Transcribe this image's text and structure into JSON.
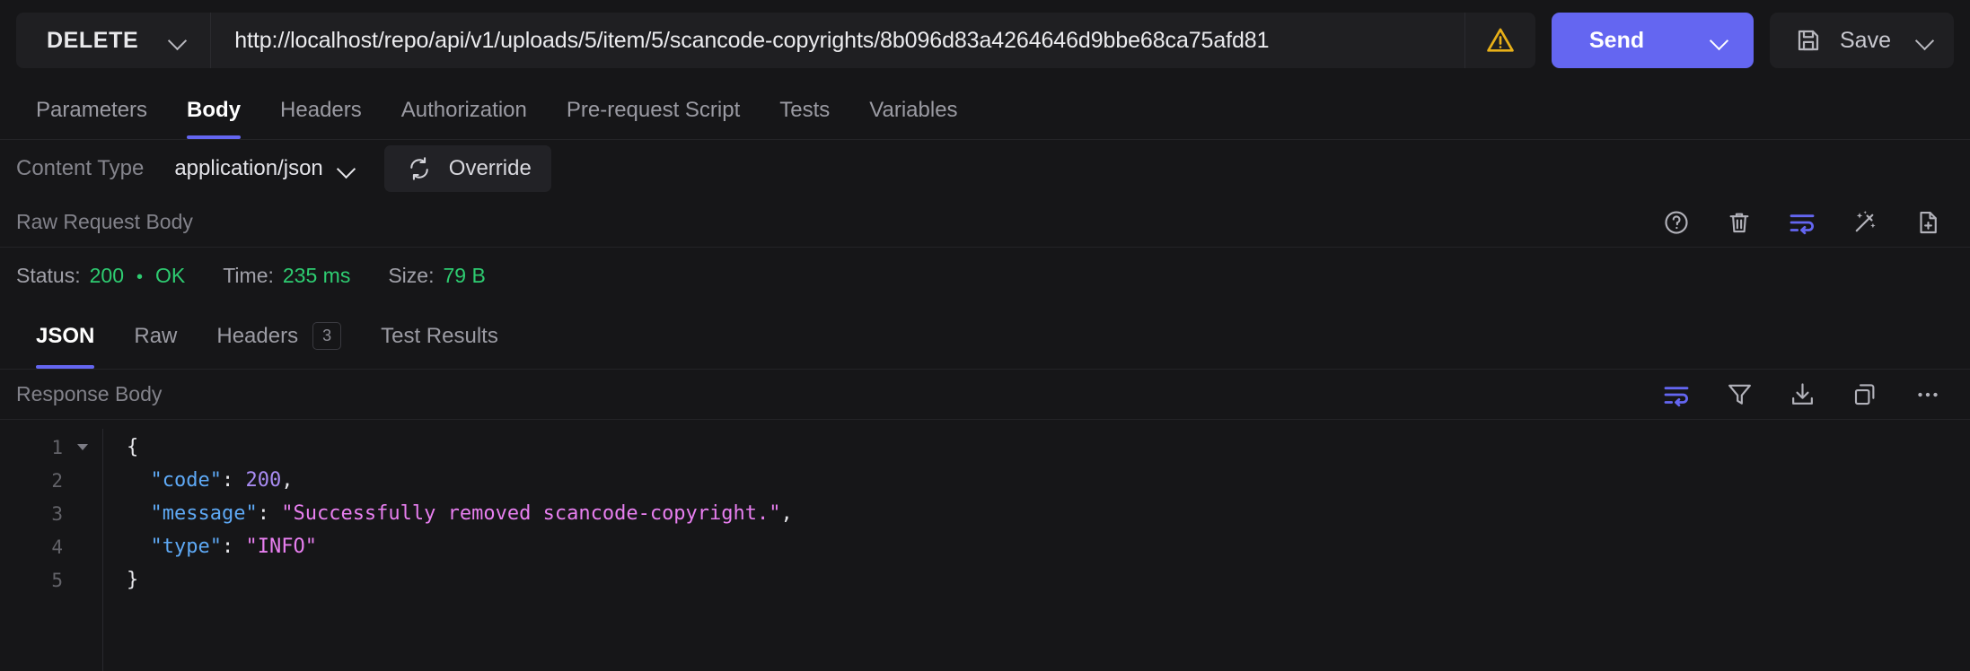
{
  "request_bar": {
    "method": "DELETE",
    "method_icon": "chevron-down-icon",
    "url": "http://localhost/repo/api/v1/uploads/5/item/5/scancode-copyrights/8b096d83a4264646d9bbe68ca75afd81",
    "url_placeholder": "Enter request URL",
    "warning_icon": "warning-triangle-icon",
    "warning_color": "#e8b018",
    "send_label": "Send",
    "send_icon": "chevron-down-icon",
    "send_color": "#6466f1",
    "save_label": "Save",
    "save_icon": "save-disk-icon",
    "save_chevron_icon": "chevron-down-icon"
  },
  "request_tabs": {
    "items": [
      {
        "label": "Parameters",
        "active": false
      },
      {
        "label": "Body",
        "active": true
      },
      {
        "label": "Headers",
        "active": false
      },
      {
        "label": "Authorization",
        "active": false
      },
      {
        "label": "Pre-request Script",
        "active": false
      },
      {
        "label": "Tests",
        "active": false
      },
      {
        "label": "Variables",
        "active": false
      }
    ],
    "active_indicator_color": "#6466f1"
  },
  "content_type": {
    "label": "Content Type",
    "value": "application/json",
    "chevron_icon": "chevron-down-icon",
    "override_label": "Override",
    "override_icon": "refresh-sync-icon"
  },
  "request_body_section": {
    "title": "Raw Request Body",
    "icons": [
      {
        "name": "help-circle-icon",
        "active": false
      },
      {
        "name": "trash-delete-icon",
        "active": false
      },
      {
        "name": "word-wrap-icon",
        "active": true
      },
      {
        "name": "magic-wand-beautify-icon",
        "active": false
      },
      {
        "name": "file-add-icon",
        "active": false
      }
    ],
    "active_icon_color": "#6466f1"
  },
  "status": {
    "status_label": "Status:",
    "status_code": "200",
    "separator": "•",
    "status_text": "OK",
    "time_label": "Time:",
    "time_value": "235 ms",
    "size_label": "Size:",
    "size_value": "79 B",
    "value_color": "#2ecc71"
  },
  "response_tabs": {
    "items": [
      {
        "label": "JSON",
        "active": true,
        "badge": null
      },
      {
        "label": "Raw",
        "active": false,
        "badge": null
      },
      {
        "label": "Headers",
        "active": false,
        "badge": "3"
      },
      {
        "label": "Test Results",
        "active": false,
        "badge": null
      }
    ]
  },
  "response_body_section": {
    "title": "Response Body",
    "icons": [
      {
        "name": "word-wrap-icon",
        "active": true
      },
      {
        "name": "filter-funnel-icon",
        "active": false
      },
      {
        "name": "download-icon",
        "active": false
      },
      {
        "name": "copy-icon",
        "active": false
      },
      {
        "name": "more-options-icon",
        "active": false
      }
    ]
  },
  "code_viewer": {
    "line_numbers": [
      "1",
      "2",
      "3",
      "4",
      "5"
    ],
    "fold_on_line": 1,
    "lines": [
      {
        "num": "1",
        "tokens": [
          {
            "t": "{",
            "c": "punc"
          }
        ]
      },
      {
        "num": "2",
        "tokens": [
          {
            "t": "  ",
            "c": "punc"
          },
          {
            "t": "\"code\"",
            "c": "key"
          },
          {
            "t": ": ",
            "c": "punc"
          },
          {
            "t": "200",
            "c": "num"
          },
          {
            "t": ",",
            "c": "punc"
          }
        ]
      },
      {
        "num": "3",
        "tokens": [
          {
            "t": "  ",
            "c": "punc"
          },
          {
            "t": "\"message\"",
            "c": "key"
          },
          {
            "t": ": ",
            "c": "punc"
          },
          {
            "t": "\"Successfully removed scancode-copyright.\"",
            "c": "str"
          },
          {
            "t": ",",
            "c": "punc"
          }
        ]
      },
      {
        "num": "4",
        "tokens": [
          {
            "t": "  ",
            "c": "punc"
          },
          {
            "t": "\"type\"",
            "c": "key"
          },
          {
            "t": ": ",
            "c": "punc"
          },
          {
            "t": "\"INFO\"",
            "c": "str"
          }
        ]
      },
      {
        "num": "5",
        "tokens": [
          {
            "t": "}",
            "c": "punc"
          }
        ]
      }
    ],
    "raw_json": {
      "code": 200,
      "message": "Successfully removed scancode-copyright.",
      "type": "INFO"
    },
    "colors": {
      "key": "#5ea9f5",
      "number": "#a98cf3",
      "string": "#e87ff0",
      "punctuation": "#e8e8ec",
      "line_number": "#636369"
    }
  }
}
